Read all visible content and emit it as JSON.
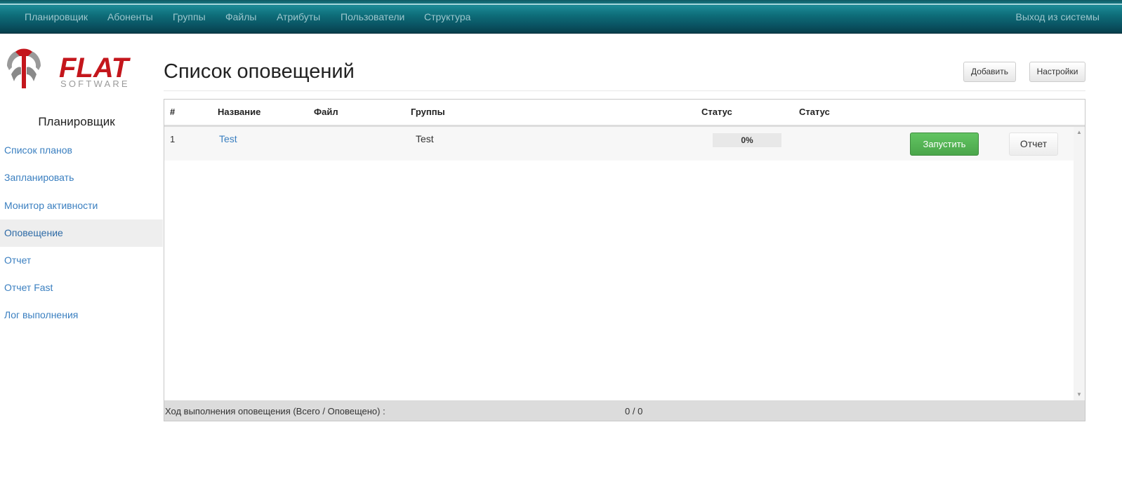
{
  "topnav": {
    "items": [
      "Планировщик",
      "Абоненты",
      "Группы",
      "Файлы",
      "Атрибуты",
      "Пользователи",
      "Структура"
    ],
    "logout": "Выход из системы"
  },
  "logo": {
    "brand": "FLAT",
    "sub": "SOFTWARE",
    "brand_color": "#c4161c"
  },
  "sidebar": {
    "title": "Планировщик",
    "items": [
      {
        "label": "Список планов"
      },
      {
        "label": "Запланировать"
      },
      {
        "label": "Монитор активности"
      },
      {
        "label": "Оповещение",
        "active": true
      },
      {
        "label": "Отчет"
      },
      {
        "label": "Отчет Fast"
      },
      {
        "label": "Лог выполнения"
      }
    ]
  },
  "header": {
    "title": "Список оповещений",
    "add_label": "Добавить",
    "settings_label": "Настройки"
  },
  "table": {
    "columns": [
      "#",
      "Название",
      "Файл",
      "Группы",
      "Статус",
      "Статус"
    ],
    "rows": [
      {
        "num": "1",
        "name": "Test",
        "file": "",
        "groups": "Test",
        "progress_text": "0%",
        "progress": 0,
        "run_label": "Запустить",
        "report_label": "Отчет"
      }
    ]
  },
  "footer": {
    "label": "Ход выполнения оповещения (Всего / Оповещено) :",
    "value": "0 / 0"
  },
  "colors": {
    "topbar": "#0e6e7a",
    "link": "#3a7fc0",
    "success": "#5cb85c"
  }
}
